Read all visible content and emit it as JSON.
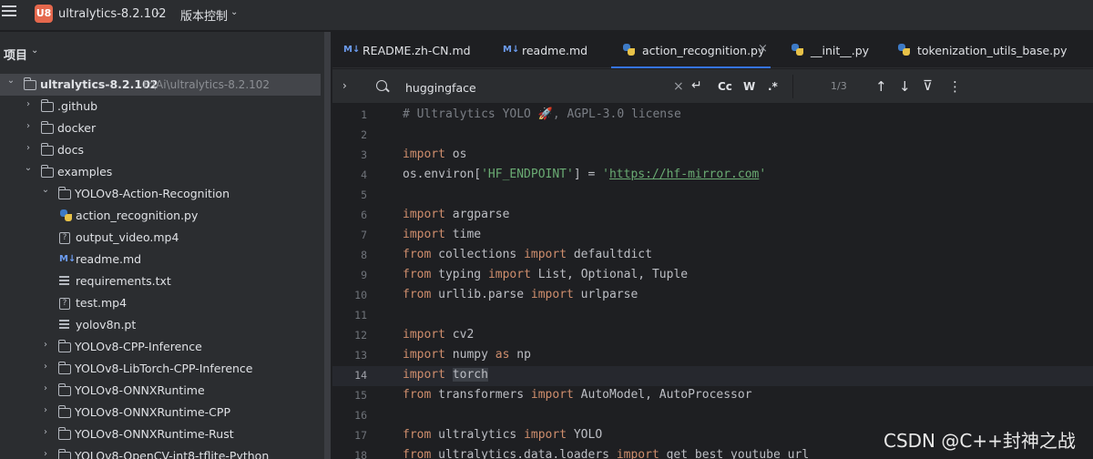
{
  "titlebar": {
    "project_badge": "U8",
    "project_name": "ultralytics-8.2.102",
    "vcs_label": "版本控制"
  },
  "project_panel": {
    "title": "项目",
    "tree": [
      {
        "label": "ultralytics-8.2.102",
        "path": "F:\\Ai\\ultralytics-8.2.102",
        "type": "folder",
        "expanded": true,
        "bold": true
      },
      {
        "label": ".github",
        "type": "folder",
        "expanded": false
      },
      {
        "label": "docker",
        "type": "folder",
        "expanded": false
      },
      {
        "label": "docs",
        "type": "folder",
        "expanded": false
      },
      {
        "label": "examples",
        "type": "folder",
        "expanded": true
      },
      {
        "label": "YOLOv8-Action-Recognition",
        "type": "folder",
        "expanded": true
      },
      {
        "label": "action_recognition.py",
        "type": "py"
      },
      {
        "label": "output_video.mp4",
        "type": "unknown"
      },
      {
        "label": "readme.md",
        "type": "md"
      },
      {
        "label": "requirements.txt",
        "type": "txt"
      },
      {
        "label": "test.mp4",
        "type": "unknown"
      },
      {
        "label": "yolov8n.pt",
        "type": "txt"
      },
      {
        "label": "YOLOv8-CPP-Inference",
        "type": "folder",
        "expanded": false
      },
      {
        "label": "YOLOv8-LibTorch-CPP-Inference",
        "type": "folder",
        "expanded": false
      },
      {
        "label": "YOLOv8-ONNXRuntime",
        "type": "folder",
        "expanded": false
      },
      {
        "label": "YOLOv8-ONNXRuntime-CPP",
        "type": "folder",
        "expanded": false
      },
      {
        "label": "YOLOv8-ONNXRuntime-Rust",
        "type": "folder",
        "expanded": false
      },
      {
        "label": "YOLOv8-OpenCV-int8-tflite-Python",
        "type": "folder",
        "expanded": false
      }
    ]
  },
  "tabs": [
    {
      "label": "README.zh-CN.md",
      "type": "md",
      "active": false
    },
    {
      "label": "readme.md",
      "type": "md",
      "active": false
    },
    {
      "label": "action_recognition.py",
      "type": "py",
      "active": true
    },
    {
      "label": "__init__.py",
      "type": "py",
      "active": false
    },
    {
      "label": "tokenization_utils_base.py",
      "type": "py",
      "active": false
    }
  ],
  "findbar": {
    "query": "huggingface",
    "clear": "×",
    "replace_icon": "↵",
    "match_case": "Cc",
    "whole_word": "W",
    "regex": ".*",
    "count": "1/3",
    "prev": "↑",
    "next": "↓",
    "filter": "⊽",
    "more": "⋮"
  },
  "code": {
    "current_line": 14,
    "lines": [
      [
        [
          "cmt",
          "# Ultralytics YOLO 🚀, AGPL-3.0 license"
        ]
      ],
      [],
      [
        [
          "kw",
          "import"
        ],
        [
          "",
          " os"
        ]
      ],
      [
        [
          "",
          "os.environ["
        ],
        [
          "str",
          "'HF_ENDPOINT'"
        ],
        [
          "",
          "] = "
        ],
        [
          "str",
          "'"
        ],
        [
          "url",
          "https://hf-mirror.com"
        ],
        [
          "str",
          "'"
        ]
      ],
      [],
      [
        [
          "kw",
          "import"
        ],
        [
          "",
          " argparse"
        ]
      ],
      [
        [
          "kw",
          "import"
        ],
        [
          "",
          " time"
        ]
      ],
      [
        [
          "kw",
          "from"
        ],
        [
          "",
          " collections "
        ],
        [
          "kw",
          "import"
        ],
        [
          "",
          " defaultdict"
        ]
      ],
      [
        [
          "kw",
          "from"
        ],
        [
          "",
          " typing "
        ],
        [
          "kw",
          "import"
        ],
        [
          "",
          " List, Optional, Tuple"
        ]
      ],
      [
        [
          "kw",
          "from"
        ],
        [
          "",
          " urllib.parse "
        ],
        [
          "kw",
          "import"
        ],
        [
          "",
          " urlparse"
        ]
      ],
      [],
      [
        [
          "kw",
          "import"
        ],
        [
          "",
          " cv2"
        ]
      ],
      [
        [
          "kw",
          "import"
        ],
        [
          "",
          " numpy "
        ],
        [
          "kw",
          "as"
        ],
        [
          "",
          " np"
        ]
      ],
      [
        [
          "kw",
          "import"
        ],
        [
          "",
          " "
        ],
        [
          "hl",
          "torch"
        ]
      ],
      [
        [
          "kw",
          "from"
        ],
        [
          "",
          " transformers "
        ],
        [
          "kw",
          "import"
        ],
        [
          "",
          " AutoModel, AutoProcessor"
        ]
      ],
      [],
      [
        [
          "kw",
          "from"
        ],
        [
          "",
          " ultralytics "
        ],
        [
          "kw",
          "import"
        ],
        [
          "",
          " YOLO"
        ]
      ],
      [
        [
          "kw",
          "from"
        ],
        [
          "",
          " ultralytics.data.loaders "
        ],
        [
          "kw",
          "import"
        ],
        [
          "",
          " get_best_youtube_url"
        ]
      ]
    ]
  },
  "watermark": "CSDN @C++封神之战",
  "colors": {
    "accent": "#3574f0",
    "keyword": "#cf8e6d",
    "string": "#6aab73",
    "comment": "#7a7e85",
    "badge": "#e5684d"
  }
}
